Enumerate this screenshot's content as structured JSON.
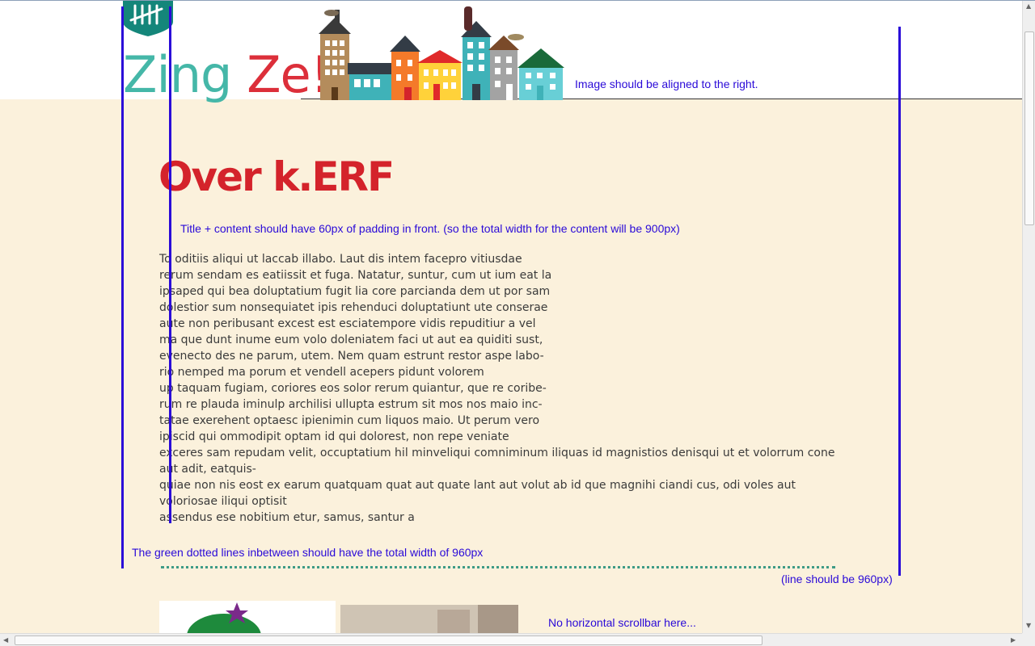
{
  "site": {
    "brand_part1": "Zing ",
    "brand_part2": "Ze!",
    "logo_icon": "tally-shield-icon"
  },
  "notes": {
    "image_align": "Image should be aligned to the right.",
    "padding": "Title + content should have 60px of padding in front. (so the total width for the content will be 900px)",
    "dotted_width": "The green dotted lines inbetween should have the total width of 960px",
    "line_width": "(line should be 960px)",
    "no_scrollbar": "No horizontal scrollbar here..."
  },
  "page": {
    "title": "Over k.ERF",
    "lines": [
      "To oditiis aliqui ut laccab illabo. Laut dis intem facepro vitiusdae",
      "rerum sendam es eatiissit et fuga. Natatur, suntur, cum ut ium eat la",
      "ipsaped qui bea doluptatium fugit lia core parcianda dem ut por sam",
      "dolestior sum nonsequiatet ipis rehenduci doluptatiunt ute conserae",
      "aute non peribusant excest est esciatempore vidis repuditiur a vel",
      "ma que dunt inume eum volo doleniatem faci ut aut ea quiditi sust,",
      "evenecto des ne parum, utem. Nem quam estrunt restor aspe labo-",
      "rio nemped ma porum et vendell acepers pidunt volorem",
      "up taquam fugiam, coriores eos solor rerum quiantur, que re coribe-",
      "rum re plauda iminulp archilisi ullupta estrum sit mos nos maio inc-",
      "tatae exerehent optaesc ipienimin cum liquos maio. Ut perum vero",
      "ipiscid qui ommodipit optam id qui dolorest, non repe veniate"
    ],
    "wrap_lines": [
      "exceres sam repudam velit, occuptatium hil minveliqui comniminum iliquas id magnistios denisqui ut et volorrum cone aut adit, eatquis-",
      "quiae non nis eost ex earum quatquam quat aut quate lant aut volut ab id que magnihi ciandi cus, odi voles aut voloriosae iliqui optisit",
      "assendus ese nobitium etur, samus, santur a"
    ]
  },
  "colors": {
    "annotation": "#2a0ad8",
    "background": "#fbf1dc",
    "title": "#d4232b",
    "brand_teal": "#45b7a8",
    "dotted": "#3e9b86"
  }
}
